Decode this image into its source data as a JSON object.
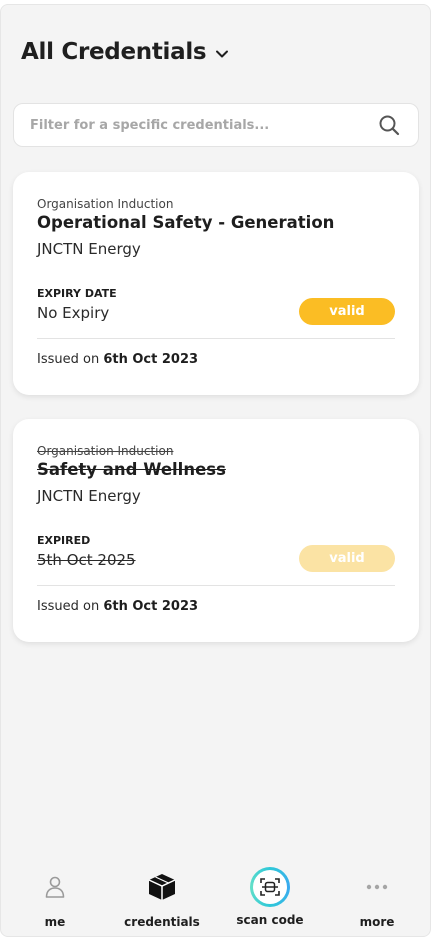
{
  "header": {
    "title": "All Credentials",
    "dropdown_icon": "chevron-down-icon"
  },
  "search": {
    "placeholder": "Filter for a specific credentials...",
    "value": "",
    "icon": "search-icon"
  },
  "credentials": [
    {
      "type": "Organisation Induction",
      "title": "Operational Safety - Generation",
      "organisation": "JNCTN Energy",
      "expiry_label": "EXPIRY DATE",
      "expiry_value": "No Expiry",
      "status": "valid",
      "issued_prefix": "Issued on",
      "issued_date": "6th Oct 2023",
      "expired": false
    },
    {
      "type": "Organisation Induction",
      "title": "Safety and Wellness",
      "organisation": "JNCTN Energy",
      "expiry_label": "EXPIRED",
      "expiry_value": "5th Oct 2025",
      "status": "valid",
      "issued_prefix": "Issued on",
      "issued_date": "6th Oct 2023",
      "expired": true
    }
  ],
  "bottom_nav": [
    {
      "label": "me",
      "icon": "person-icon"
    },
    {
      "label": "credentials",
      "icon": "credentials-icon",
      "active": true
    },
    {
      "label": "scan code",
      "icon": "scan-code-icon"
    },
    {
      "label": "more",
      "icon": "more-dots-icon"
    }
  ],
  "colors": {
    "badge_valid": "#fbbd24",
    "badge_faded": "#fbe3a4",
    "background": "#f4f4f4",
    "card": "#ffffff",
    "scan_ring": "#2fc8d8"
  }
}
